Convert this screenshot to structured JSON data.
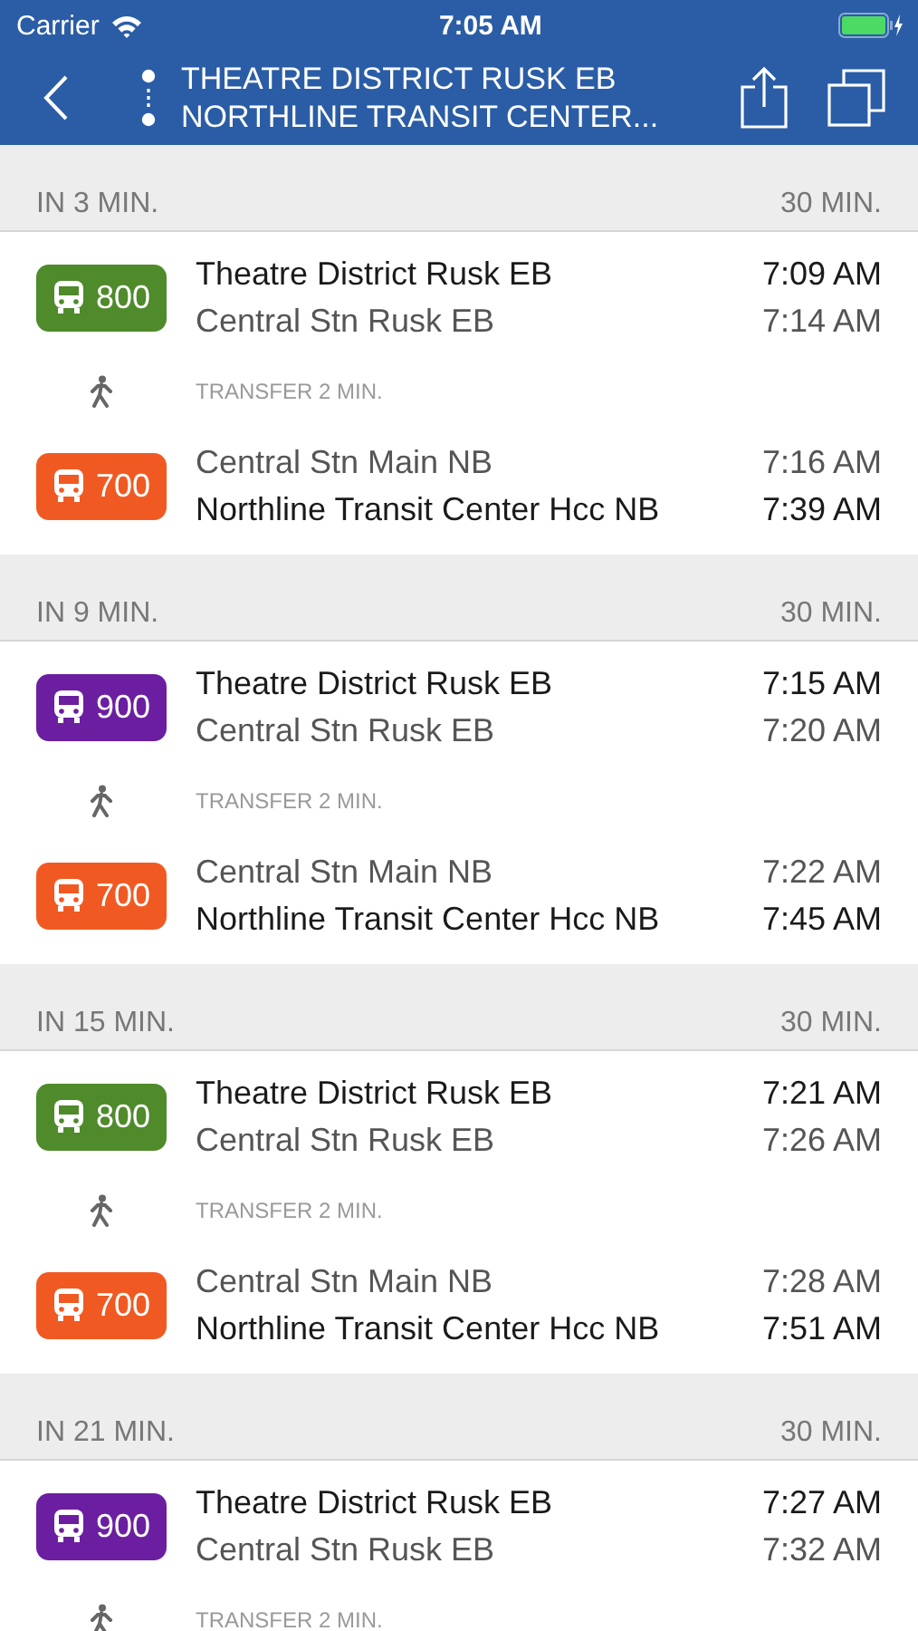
{
  "status_bar": {
    "carrier": "Carrier",
    "time": "7:05 AM"
  },
  "nav": {
    "from": "THEATRE DISTRICT RUSK EB",
    "to": "NORTHLINE TRANSIT CENTER..."
  },
  "trips": [
    {
      "departs": "IN 3 MIN.",
      "duration": "30 MIN.",
      "legs": [
        {
          "kind": "ride",
          "route": "800",
          "color": "#4f8a2b",
          "stops": [
            {
              "name": "Theatre District Rusk EB",
              "time": "7:09 AM",
              "strong": true
            },
            {
              "name": "Central Stn Rusk EB",
              "time": "7:14 AM",
              "strong": false
            }
          ]
        },
        {
          "kind": "transfer",
          "text": "TRANSFER 2 MIN."
        },
        {
          "kind": "ride",
          "route": "700",
          "color": "#f05a22",
          "stops": [
            {
              "name": "Central Stn Main NB",
              "time": "7:16 AM",
              "strong": false
            },
            {
              "name": "Northline Transit Center Hcc NB",
              "time": "7:39 AM",
              "strong": true
            }
          ]
        }
      ]
    },
    {
      "departs": "IN 9 MIN.",
      "duration": "30 MIN.",
      "legs": [
        {
          "kind": "ride",
          "route": "900",
          "color": "#6b1fa0",
          "stops": [
            {
              "name": "Theatre District Rusk EB",
              "time": "7:15 AM",
              "strong": true
            },
            {
              "name": "Central Stn Rusk EB",
              "time": "7:20 AM",
              "strong": false
            }
          ]
        },
        {
          "kind": "transfer",
          "text": "TRANSFER 2 MIN."
        },
        {
          "kind": "ride",
          "route": "700",
          "color": "#f05a22",
          "stops": [
            {
              "name": "Central Stn Main NB",
              "time": "7:22 AM",
              "strong": false
            },
            {
              "name": "Northline Transit Center Hcc NB",
              "time": "7:45 AM",
              "strong": true
            }
          ]
        }
      ]
    },
    {
      "departs": "IN 15 MIN.",
      "duration": "30 MIN.",
      "legs": [
        {
          "kind": "ride",
          "route": "800",
          "color": "#4f8a2b",
          "stops": [
            {
              "name": "Theatre District Rusk EB",
              "time": "7:21 AM",
              "strong": true
            },
            {
              "name": "Central Stn Rusk EB",
              "time": "7:26 AM",
              "strong": false
            }
          ]
        },
        {
          "kind": "transfer",
          "text": "TRANSFER 2 MIN."
        },
        {
          "kind": "ride",
          "route": "700",
          "color": "#f05a22",
          "stops": [
            {
              "name": "Central Stn Main NB",
              "time": "7:28 AM",
              "strong": false
            },
            {
              "name": "Northline Transit Center Hcc NB",
              "time": "7:51 AM",
              "strong": true
            }
          ]
        }
      ]
    },
    {
      "departs": "IN 21 MIN.",
      "duration": "30 MIN.",
      "legs": [
        {
          "kind": "ride",
          "route": "900",
          "color": "#6b1fa0",
          "stops": [
            {
              "name": "Theatre District Rusk EB",
              "time": "7:27 AM",
              "strong": true
            },
            {
              "name": "Central Stn Rusk EB",
              "time": "7:32 AM",
              "strong": false
            }
          ]
        },
        {
          "kind": "transfer",
          "text": "TRANSFER 2 MIN."
        }
      ]
    }
  ]
}
